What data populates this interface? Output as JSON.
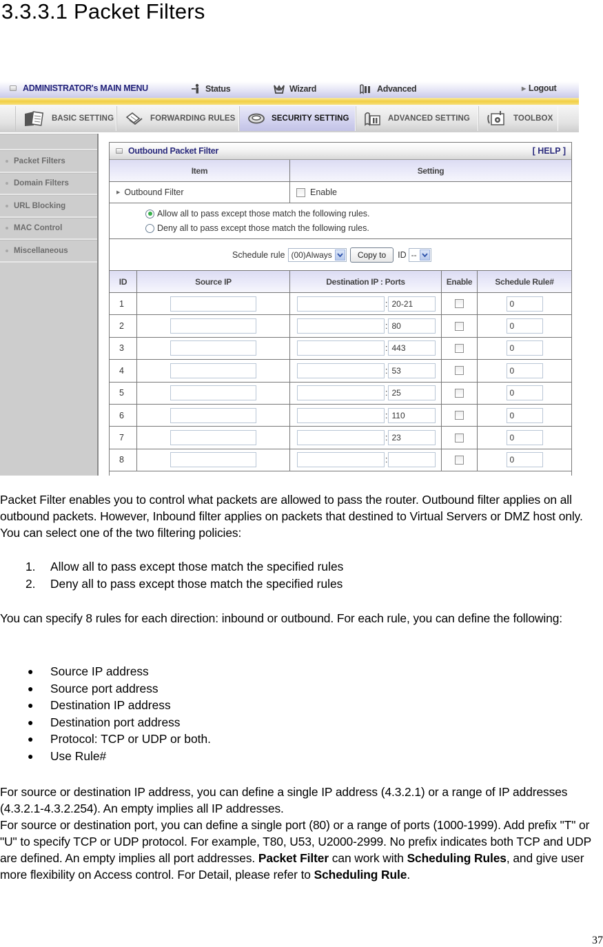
{
  "doc": {
    "heading": "3.3.3.1 Packet Filters",
    "page_number": "37"
  },
  "ui": {
    "topbar": {
      "main_menu": "ADMINISTRATOR's MAIN MENU",
      "status": "Status",
      "wizard": "Wizard",
      "advanced": "Advanced",
      "logout": "Logout"
    },
    "tabs": [
      {
        "label": "BASIC SETTING",
        "icon": "folder-doc-icon"
      },
      {
        "label": "FORWARDING RULES",
        "icon": "forwarding-icon"
      },
      {
        "label": "SECURITY SETTING",
        "icon": "security-nut-icon",
        "active": true
      },
      {
        "label": "ADVANCED SETTING",
        "icon": "advanced-book-icon"
      },
      {
        "label": "TOOLBOX",
        "icon": "toolbox-gear-icon"
      }
    ],
    "sidebar": [
      "Packet Filters",
      "Domain Filters",
      "URL Blocking",
      "MAC Control",
      "Miscellaneous"
    ],
    "panel": {
      "title": "Outbound Packet Filter",
      "help": "[ HELP ]",
      "col_item": "Item",
      "col_setting": "Setting",
      "filter_label": "Outbound Filter",
      "enable_label": "Enable",
      "enable_checked": false,
      "policy_allow": "Allow all to pass except those match the following rules.",
      "policy_deny": "Deny all to pass except those match the following rules.",
      "policy_selected": "allow",
      "schedule_label": "Schedule rule",
      "schedule_value": "(00)Always",
      "copy_to": "Copy to",
      "id_label": "ID",
      "id_value": "--"
    },
    "rules_table": {
      "headers": [
        "ID",
        "Source IP",
        "Destination IP : Ports",
        "Enable",
        "Schedule Rule#"
      ],
      "rows": [
        {
          "id": "1",
          "source_ip": "",
          "dest_ip": "",
          "port": "20-21",
          "enabled": false,
          "schedule": "0"
        },
        {
          "id": "2",
          "source_ip": "",
          "dest_ip": "",
          "port": "80",
          "enabled": false,
          "schedule": "0"
        },
        {
          "id": "3",
          "source_ip": "",
          "dest_ip": "",
          "port": "443",
          "enabled": false,
          "schedule": "0"
        },
        {
          "id": "4",
          "source_ip": "",
          "dest_ip": "",
          "port": "53",
          "enabled": false,
          "schedule": "0"
        },
        {
          "id": "5",
          "source_ip": "",
          "dest_ip": "",
          "port": "25",
          "enabled": false,
          "schedule": "0"
        },
        {
          "id": "6",
          "source_ip": "",
          "dest_ip": "",
          "port": "110",
          "enabled": false,
          "schedule": "0"
        },
        {
          "id": "7",
          "source_ip": "",
          "dest_ip": "",
          "port": "23",
          "enabled": false,
          "schedule": "0"
        },
        {
          "id": "8",
          "source_ip": "",
          "dest_ip": "",
          "port": "",
          "enabled": false,
          "schedule": "0"
        }
      ]
    }
  },
  "text": {
    "intro": "Packet Filter enables you to control what packets are allowed to pass the router. Outbound filter applies on all outbound packets. However, Inbound filter applies on packets that destined to Virtual Servers or DMZ host only. You can select one of the two filtering policies:",
    "policies": [
      "Allow all to pass except those match the specified rules",
      "Deny all to pass except those match the specified rules"
    ],
    "rules_intro": "You can specify 8 rules for each direction: inbound or outbound. For each rule, you can define the following:",
    "rule_fields": [
      "Source IP address",
      "Source port address",
      "Destination IP address",
      "Destination port address",
      "Protocol: TCP or UDP or both.",
      "Use Rule#"
    ],
    "ip_para": "For source or destination IP address, you can define a single IP address (4.3.2.1) or a range of IP addresses (4.3.2.1-4.3.2.254). An empty implies all IP addresses.",
    "port_para_1": "For source or destination port, you can define a single port (80) or a range of ports (1000-1999). Add prefix \"T\" or \"U\" to specify TCP or UDP protocol. For example, T80, U53, U2000-2999. No prefix indicates both TCP and UDP are defined. An empty implies all port addresses. ",
    "bold_packet_filter": "Packet Filter",
    "port_para_2": " can work with ",
    "bold_scheduling_rules": "Scheduling Rules",
    "port_para_3": ", and give user more flexibility on Access control. For Detail, please refer to ",
    "bold_scheduling_rule": "Scheduling Rule",
    "port_para_end": "."
  }
}
